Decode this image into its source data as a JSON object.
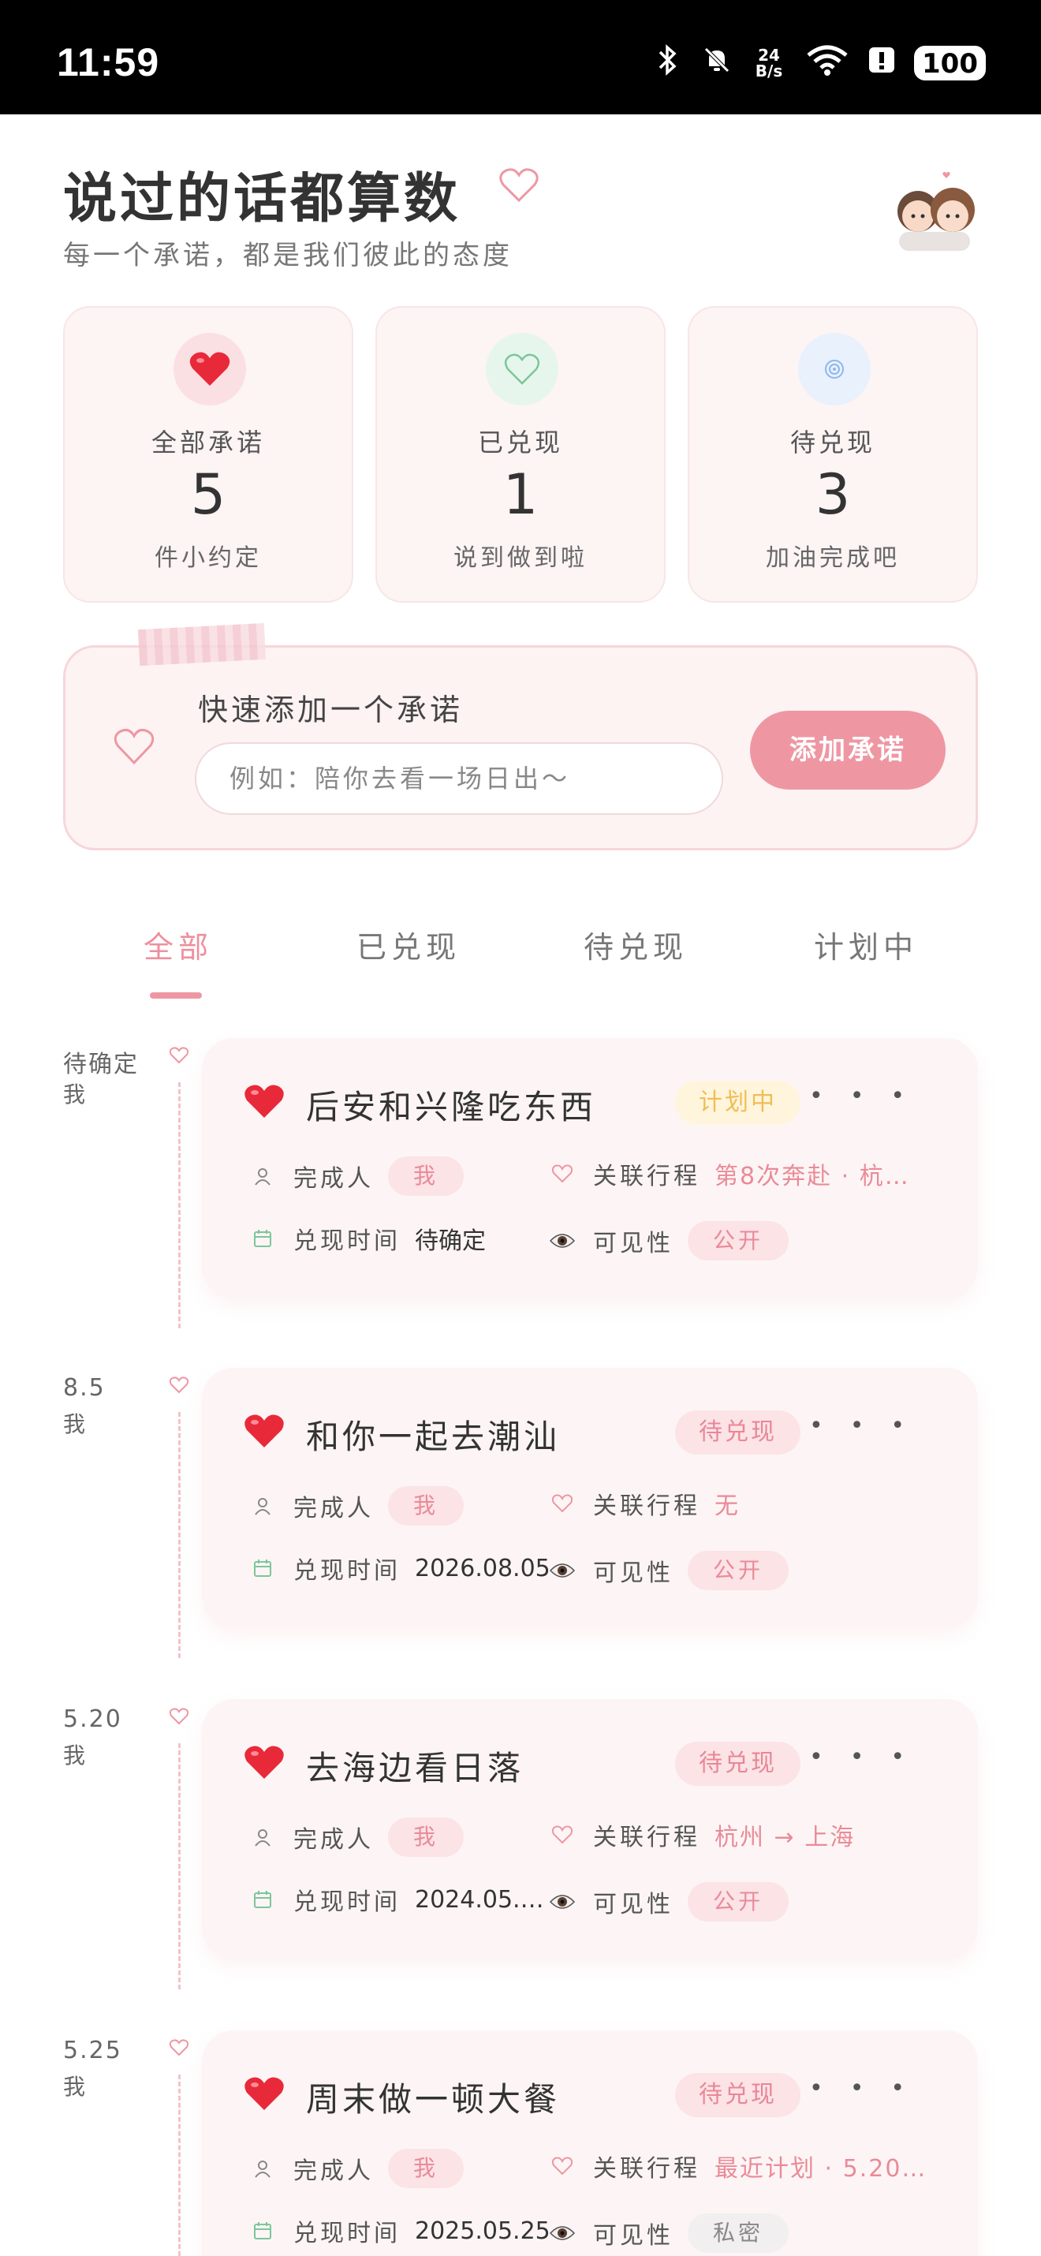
{
  "status_bar": {
    "time": "11:59",
    "net_speed_top": "24",
    "net_speed_bottom": "B/s",
    "battery": "100"
  },
  "header": {
    "title": "说过的话都算数",
    "subtitle": "每一个承诺，都是我们彼此的态度"
  },
  "stats": [
    {
      "label": "全部承诺",
      "value": "5",
      "note": "件小约定",
      "icon": "red-heart-icon",
      "color": "#e8293a"
    },
    {
      "label": "已兑现",
      "value": "1",
      "note": "说到做到啦",
      "icon": "green-heart-icon",
      "color": "#7cc69a"
    },
    {
      "label": "待兑现",
      "value": "3",
      "note": "加油完成吧",
      "icon": "blue-target-icon",
      "color": "#8fb6ee"
    }
  ],
  "quick_add": {
    "title": "快速添加一个承诺",
    "placeholder": "例如：陪你去看一场日出～",
    "button": "添加承诺"
  },
  "tabs": [
    "全部",
    "已兑现",
    "待兑现",
    "计划中"
  ],
  "active_tab": "全部",
  "labels": {
    "owner": "完成人",
    "trip": "关联行程",
    "time": "兑现时间",
    "visibility": "可见性"
  },
  "promises": [
    {
      "date": "待确定",
      "who": "我",
      "title": "后安和兴隆吃东西",
      "status": "计划中",
      "owner": "我",
      "trip": "第8次奔赴 · 杭…",
      "time": "待确定",
      "visibility": "公开"
    },
    {
      "date": "8.5",
      "who": "我",
      "title": "和你一起去潮汕",
      "status": "待兑现",
      "owner": "我",
      "trip": "无",
      "time": "2026.08.05",
      "visibility": "公开"
    },
    {
      "date": "5.20",
      "who": "我",
      "title": "去海边看日落",
      "status": "待兑现",
      "owner": "我",
      "trip": "杭州 → 上海",
      "time": "2024.05.…",
      "visibility": "公开"
    },
    {
      "date": "5.25",
      "who": "我",
      "title": "周末做一顿大餐",
      "status": "待兑现",
      "owner": "我",
      "trip": "最近计划 · 5.20…",
      "time": "2025.05.25",
      "visibility": "私密"
    }
  ],
  "colors": {
    "accent": "#ee97a3",
    "card_bg": "#fdf5f5",
    "status_pending": "#e88796",
    "status_planning": "#f0bd56"
  }
}
